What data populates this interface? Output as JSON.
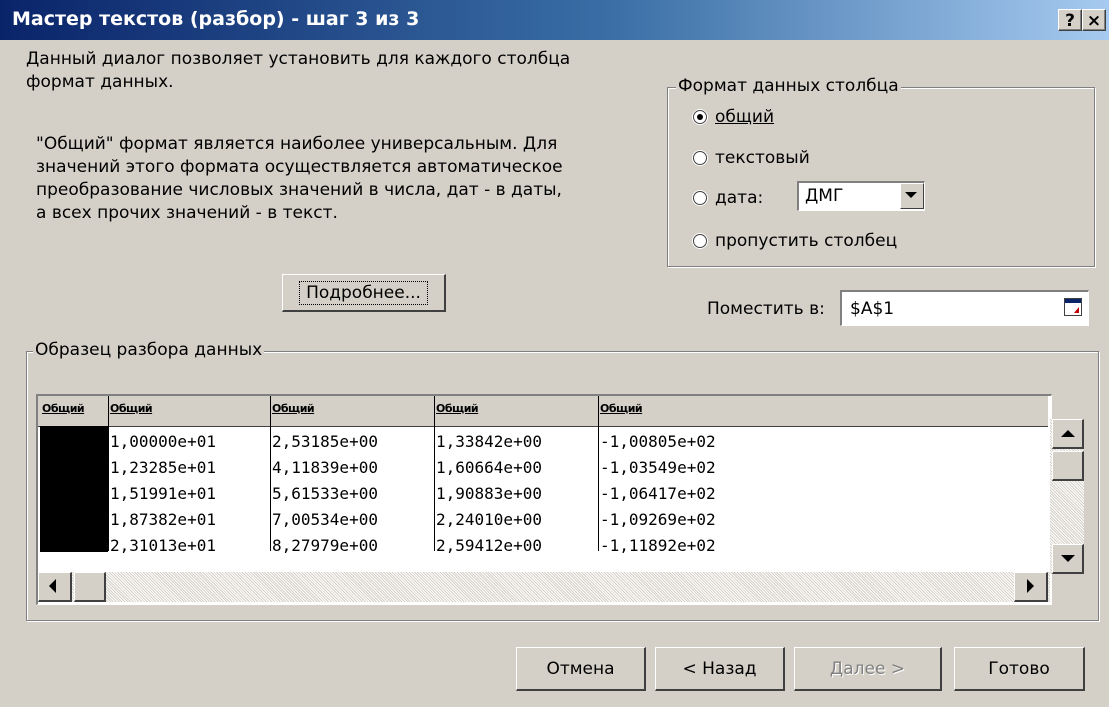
{
  "window": {
    "title": "Мастер текстов (разбор) - шаг 3 из 3",
    "help_label": "?",
    "close_label": "×"
  },
  "description": {
    "line1": "Данный диалог позволяет установить для каждого столбца",
    "line2": "формат данных.",
    "detail1": "\"Общий\" формат является наиболее универсальным. Для",
    "detail2": "значений этого формата осуществляется автоматическое",
    "detail3": "преобразование числовых значений в числа, дат - в даты,",
    "detail4": "а всех прочих значений - в текст."
  },
  "format_group": {
    "label": "Формат данных столбца",
    "options": [
      {
        "label": "общий",
        "checked": true
      },
      {
        "label": "текстовый",
        "checked": false
      },
      {
        "label": "дата:",
        "checked": false
      },
      {
        "label": "пропустить столбец",
        "checked": false
      }
    ],
    "date_format": "ДМГ"
  },
  "more_button": {
    "label": "Подробнее..."
  },
  "destination": {
    "label": "Поместить в:",
    "value": "$A$1"
  },
  "preview": {
    "label": "Образец разбора данных",
    "headers": [
      "Общий",
      "Общий",
      "Общий",
      "Общий",
      "Общий"
    ],
    "rows": [
      [
        "1,00000e+01",
        "2,53185e+00",
        "1,33842e+00",
        "-1,00805e+02"
      ],
      [
        "1,23285e+01",
        "4,11839e+00",
        "1,60664e+00",
        "-1,03549e+02"
      ],
      [
        "1,51991e+01",
        "5,61533e+00",
        "1,90883e+00",
        "-1,06417e+02"
      ],
      [
        "1,87382e+01",
        "7,00534e+00",
        "2,24010e+00",
        "-1,09269e+02"
      ],
      [
        "2,31013e+01",
        "8,27979e+00",
        "2,59412e+00",
        "-1,11892e+02"
      ]
    ]
  },
  "buttons": {
    "cancel": "Отмена",
    "back": "< Назад",
    "next": "Далее >",
    "finish": "Готово"
  }
}
